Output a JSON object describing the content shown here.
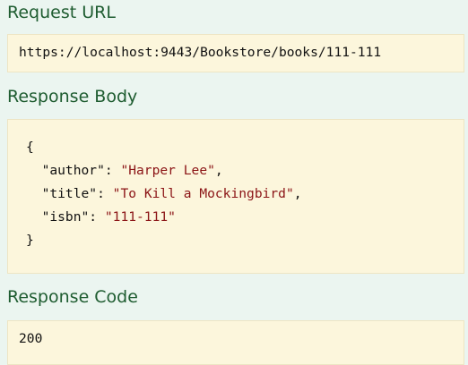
{
  "request_url": {
    "heading": "Request URL",
    "value": "https://localhost:9443/Bookstore/books/111-111"
  },
  "response_body": {
    "heading": "Response Body",
    "open_brace": "{",
    "close_brace": "}",
    "fields": [
      {
        "key": "\"author\"",
        "value": "\"Harper Lee\"",
        "sep": ","
      },
      {
        "key": "\"title\"",
        "value": "\"To Kill a Mockingbird\"",
        "sep": ","
      },
      {
        "key": "\"isbn\"",
        "value": "\"111-111\"",
        "sep": ""
      }
    ]
  },
  "response_code": {
    "heading": "Response Code",
    "value": "200"
  },
  "colors": {
    "heading": "#1e5c30",
    "box_bg": "#fcf6dc",
    "string": "#8b1416",
    "page_bg": "#ebf5f0"
  }
}
